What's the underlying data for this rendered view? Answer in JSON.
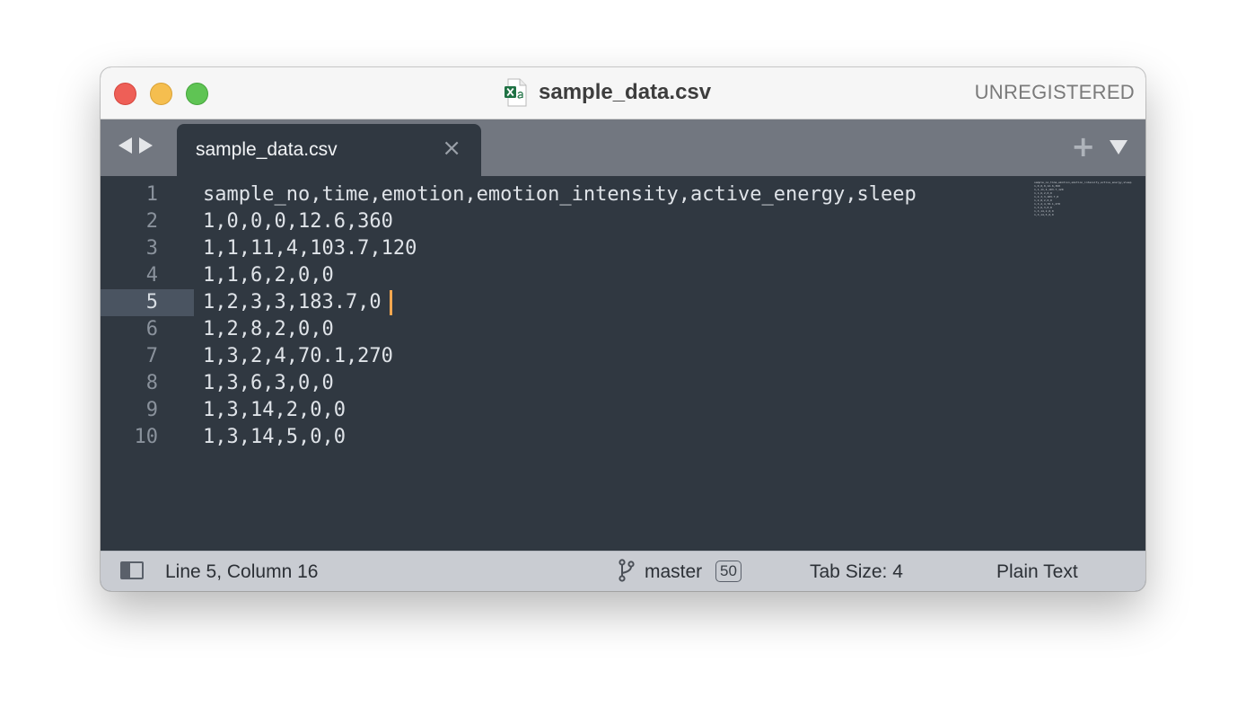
{
  "window": {
    "title": "sample_data.csv",
    "registration": "UNREGISTERED",
    "file_icon": "spreadsheet-file-icon"
  },
  "tabs": [
    {
      "label": "sample_data.csv",
      "close": "×"
    }
  ],
  "tabbar": {
    "new_tab": "+"
  },
  "editor": {
    "current_line": 5,
    "lines": [
      {
        "n": "1",
        "text": "sample_no,time,emotion,emotion_intensity,active_energy,sleep"
      },
      {
        "n": "2",
        "text": "1,0,0,0,12.6,360"
      },
      {
        "n": "3",
        "text": "1,1,11,4,103.7,120"
      },
      {
        "n": "4",
        "text": "1,1,6,2,0,0"
      },
      {
        "n": "5",
        "text": "1,2,3,3,183.7,0"
      },
      {
        "n": "6",
        "text": "1,2,8,2,0,0"
      },
      {
        "n": "7",
        "text": "1,3,2,4,70.1,270"
      },
      {
        "n": "8",
        "text": "1,3,6,3,0,0"
      },
      {
        "n": "9",
        "text": "1,3,14,2,0,0"
      },
      {
        "n": "10",
        "text": "1,3,14,5,0,0"
      }
    ],
    "caret_color": "#f5a74f"
  },
  "status": {
    "position": "Line 5, Column 16",
    "branch": "master",
    "changes": "50",
    "tab_size": "Tab Size: 4",
    "syntax": "Plain Text"
  },
  "colors": {
    "editor_bg": "#303841",
    "tabbar_bg": "#727780",
    "statusbar_bg": "#c9ccd2",
    "close": "#ee5f57",
    "minimize": "#f5be4f",
    "maximize": "#5fc454"
  }
}
